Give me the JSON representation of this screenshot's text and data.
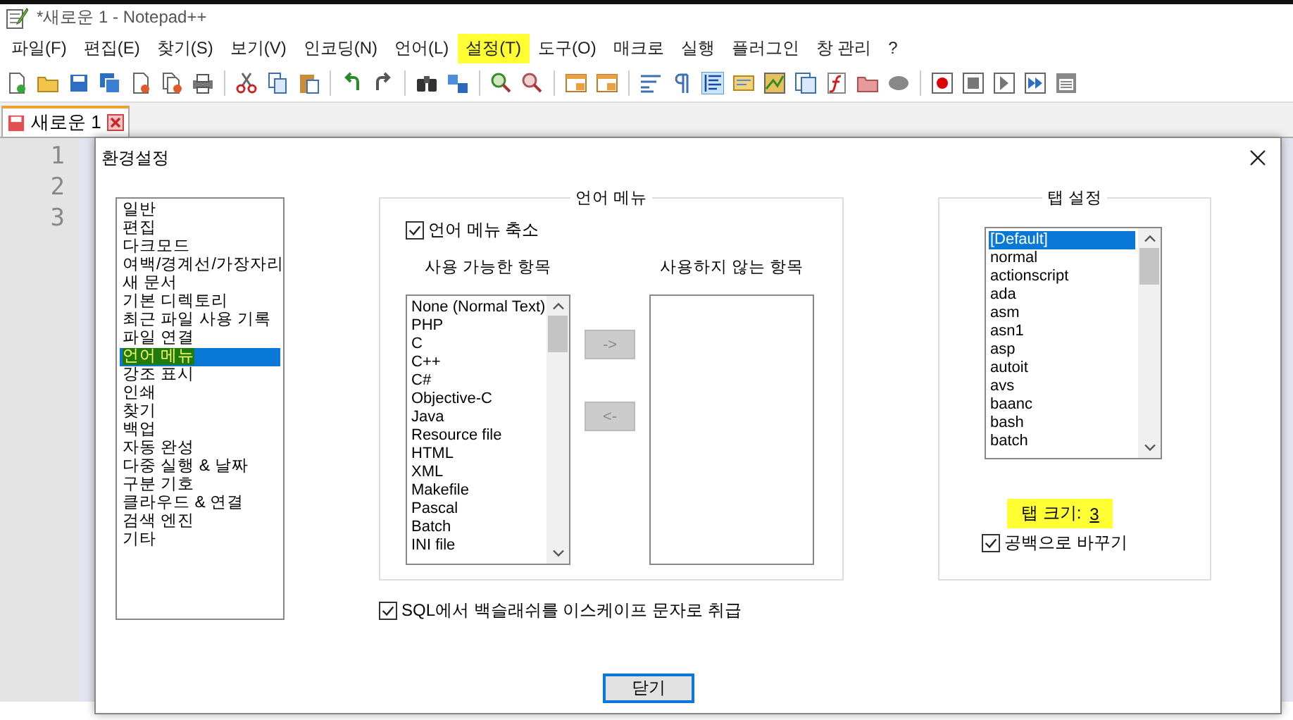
{
  "window": {
    "title": "*새로운 1 - Notepad++"
  },
  "menu": [
    {
      "label": "파일(F)",
      "highlighted": false
    },
    {
      "label": "편집(E)",
      "highlighted": false
    },
    {
      "label": "찾기(S)",
      "highlighted": false
    },
    {
      "label": "보기(V)",
      "highlighted": false
    },
    {
      "label": "인코딩(N)",
      "highlighted": false
    },
    {
      "label": "언어(L)",
      "highlighted": false
    },
    {
      "label": "설정(T)",
      "highlighted": true
    },
    {
      "label": "도구(O)",
      "highlighted": false
    },
    {
      "label": "매크로",
      "highlighted": false
    },
    {
      "label": "실행",
      "highlighted": false
    },
    {
      "label": "플러그인",
      "highlighted": false
    },
    {
      "label": "창 관리",
      "highlighted": false
    },
    {
      "label": "?",
      "highlighted": false
    }
  ],
  "tabs": [
    {
      "label": "새로운 1",
      "selected": true
    }
  ],
  "editor": {
    "line_numbers": [
      "1",
      "2",
      "3"
    ]
  },
  "dialog": {
    "title": "환경설정",
    "categories": [
      {
        "label": "일반",
        "selected": false,
        "highlighted": false
      },
      {
        "label": "편집",
        "selected": false,
        "highlighted": false
      },
      {
        "label": "다크모드",
        "selected": false,
        "highlighted": false
      },
      {
        "label": "여백/경계선/가장자리",
        "selected": false,
        "highlighted": false
      },
      {
        "label": "새 문서",
        "selected": false,
        "highlighted": false
      },
      {
        "label": "기본 디렉토리",
        "selected": false,
        "highlighted": false
      },
      {
        "label": "최근 파일 사용 기록",
        "selected": false,
        "highlighted": false
      },
      {
        "label": "파일 연결",
        "selected": false,
        "highlighted": false
      },
      {
        "label": "언어 메뉴",
        "selected": true,
        "highlighted": true
      },
      {
        "label": "강조 표시",
        "selected": false,
        "highlighted": false
      },
      {
        "label": "인쇄",
        "selected": false,
        "highlighted": false
      },
      {
        "label": "찾기",
        "selected": false,
        "highlighted": false
      },
      {
        "label": "백업",
        "selected": false,
        "highlighted": false
      },
      {
        "label": "자동 완성",
        "selected": false,
        "highlighted": false
      },
      {
        "label": "다중 실행 & 날짜",
        "selected": false,
        "highlighted": false
      },
      {
        "label": "구분 기호",
        "selected": false,
        "highlighted": false
      },
      {
        "label": "클라우드 & 연결",
        "selected": false,
        "highlighted": false
      },
      {
        "label": "검색 엔진",
        "selected": false,
        "highlighted": false
      },
      {
        "label": "기타",
        "selected": false,
        "highlighted": false
      }
    ],
    "language_menu": {
      "title": "언어 메뉴",
      "compact": {
        "label": "언어 메뉴 축소",
        "checked": true
      },
      "available_title": "사용 가능한 항목",
      "available": [
        {
          "label": "None (Normal Text)",
          "selected": false
        },
        {
          "label": "PHP",
          "selected": false
        },
        {
          "label": "C",
          "selected": false
        },
        {
          "label": "C++",
          "selected": false
        },
        {
          "label": "C#",
          "selected": false
        },
        {
          "label": "Objective-C",
          "selected": false
        },
        {
          "label": "Java",
          "selected": false
        },
        {
          "label": "Resource file",
          "selected": false
        },
        {
          "label": "HTML",
          "selected": false
        },
        {
          "label": "XML",
          "selected": false
        },
        {
          "label": "Makefile",
          "selected": false
        },
        {
          "label": "Pascal",
          "selected": false
        },
        {
          "label": "Batch",
          "selected": false
        },
        {
          "label": "INI file",
          "selected": false
        }
      ],
      "disabled_title": "사용하지 않는 항목",
      "add_button": {
        "label": "->",
        "disabled": true
      },
      "remove_button": {
        "label": "<-",
        "disabled": true
      }
    },
    "tab_settings": {
      "title": "탭 설정",
      "languages": [
        {
          "label": "[Default]",
          "selected": true
        },
        {
          "label": "normal",
          "selected": false
        },
        {
          "label": "actionscript",
          "selected": false
        },
        {
          "label": "ada",
          "selected": false
        },
        {
          "label": "asm",
          "selected": false
        },
        {
          "label": "asn1",
          "selected": false
        },
        {
          "label": "asp",
          "selected": false
        },
        {
          "label": "autoit",
          "selected": false
        },
        {
          "label": "avs",
          "selected": false
        },
        {
          "label": "baanc",
          "selected": false
        },
        {
          "label": "bash",
          "selected": false
        },
        {
          "label": "batch",
          "selected": false
        }
      ],
      "tab_size_label": "탭 크기:",
      "tab_size": "3",
      "highlighted": true,
      "replace_with_space": {
        "label": "공백으로 바꾸기",
        "checked": true
      }
    },
    "sql_backslash": {
      "label": "SQL에서 백슬래쉬를 이스케이프 문자로 취급",
      "checked": true
    },
    "close_button": "닫기"
  }
}
